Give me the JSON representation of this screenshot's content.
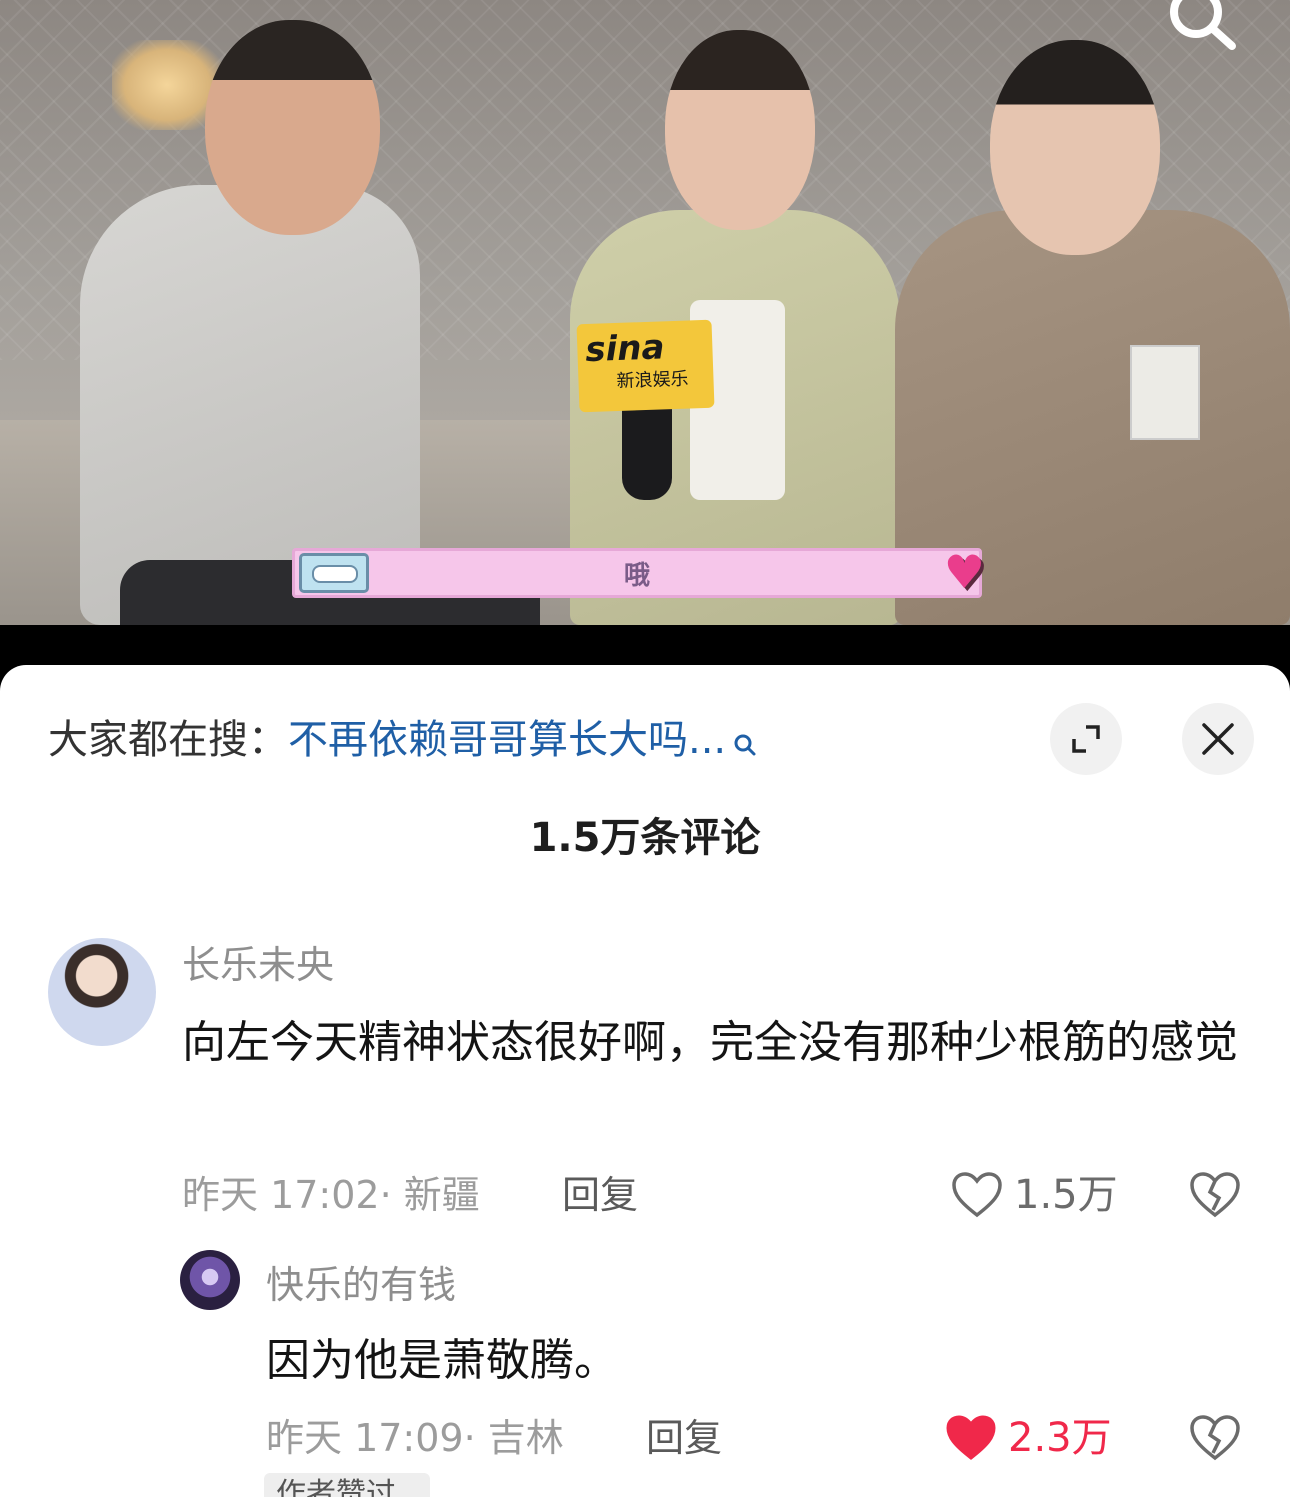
{
  "video": {
    "logo_brand": "sina",
    "logo_sub": "新浪娱乐",
    "subtitle": "哦",
    "search_icon": "search-icon"
  },
  "sheet": {
    "search_prefix": "大家都在搜：",
    "search_query": "不再依赖哥哥算长大吗...",
    "comment_count": "1.5万条评论",
    "expand_icon": "expand-icon",
    "close_icon": "close-icon"
  },
  "comments": [
    {
      "username": "长乐未央",
      "text": "向左今天精神状态很好啊，完全没有那种少根筋的感觉",
      "meta": "昨天 17:02· 新疆",
      "reply_label": "回复",
      "likes": "1.5万",
      "liked": false
    },
    {
      "username": "快乐的有钱",
      "text": "因为他是萧敬腾。",
      "meta": "昨天 17:09· 吉林",
      "reply_label": "回复",
      "likes": "2.3万",
      "liked": true,
      "tag": "作者赞过"
    }
  ],
  "colors": {
    "link_blue": "#1f5fa6",
    "like_red": "#f0284a",
    "text_dark": "#141414",
    "meta_gray": "#9c9c9c"
  }
}
